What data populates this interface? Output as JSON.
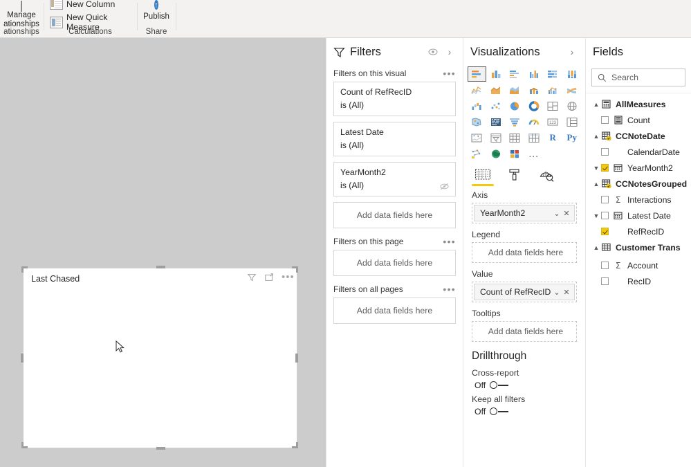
{
  "ribbon": {
    "groups": [
      {
        "caption": "ationships",
        "items": [
          {
            "label": "Manage",
            "label2": "ationships",
            "icon": "manage-relationships-icon"
          }
        ]
      },
      {
        "caption": "Calculations",
        "items": [
          {
            "label": "New Column",
            "icon": "new-column-icon"
          },
          {
            "label": "New Quick Measure",
            "icon": "new-quick-measure-icon"
          }
        ]
      },
      {
        "caption": "Share",
        "items": [
          {
            "label": "Publish",
            "icon": "publish-icon"
          }
        ]
      }
    ]
  },
  "canvas": {
    "visual": {
      "title": "Last Chased",
      "header_icons": [
        "filter-icon",
        "focus-mode-icon",
        "more-options-icon"
      ],
      "selected": true
    },
    "cursor": "mouse-pointer"
  },
  "filters": {
    "title": "Filters",
    "header_icons": [
      "hidden-eye-icon",
      "collapse-chevron-icon"
    ],
    "sections": [
      {
        "label": "Filters on this visual",
        "cards": [
          {
            "field": "Count of RefRecID",
            "state": "is (All)",
            "hidden": false
          },
          {
            "field": "Latest Date",
            "state": "is (All)",
            "hidden": false
          },
          {
            "field": "YearMonth2",
            "state": "is (All)",
            "hidden": true
          }
        ],
        "dropzone": "Add data fields here"
      },
      {
        "label": "Filters on this page",
        "cards": [],
        "dropzone": "Add data fields here"
      },
      {
        "label": "Filters on all pages",
        "cards": [],
        "dropzone": "Add data fields here"
      }
    ]
  },
  "visualizations": {
    "title": "Visualizations",
    "header_icon": "collapse-chevron-icon",
    "gallery": [
      {
        "name": "stacked-bar-chart-icon",
        "selected": true
      },
      {
        "name": "stacked-column-chart-icon",
        "selected": false
      },
      {
        "name": "clustered-bar-chart-icon",
        "selected": false
      },
      {
        "name": "clustered-column-chart-icon",
        "selected": false
      },
      {
        "name": "100-percent-stacked-bar-chart-icon",
        "selected": false
      },
      {
        "name": "100-percent-stacked-column-chart-icon",
        "selected": false
      },
      {
        "name": "line-chart-icon",
        "selected": false
      },
      {
        "name": "area-chart-icon",
        "selected": false
      },
      {
        "name": "stacked-area-chart-icon",
        "selected": false
      },
      {
        "name": "line-and-stacked-column-chart-icon",
        "selected": false
      },
      {
        "name": "line-and-clustered-column-chart-icon",
        "selected": false
      },
      {
        "name": "ribbon-chart-icon",
        "selected": false
      },
      {
        "name": "waterfall-chart-icon",
        "selected": false
      },
      {
        "name": "scatter-chart-icon",
        "selected": false
      },
      {
        "name": "pie-chart-icon",
        "selected": false
      },
      {
        "name": "donut-chart-icon",
        "selected": false
      },
      {
        "name": "treemap-icon",
        "selected": false
      },
      {
        "name": "map-icon",
        "selected": false
      },
      {
        "name": "filled-map-icon",
        "selected": false
      },
      {
        "name": "shape-map-icon",
        "selected": false
      },
      {
        "name": "funnel-chart-icon",
        "selected": false
      },
      {
        "name": "gauge-icon",
        "selected": false
      },
      {
        "name": "card-icon",
        "selected": false
      },
      {
        "name": "multi-row-card-icon",
        "selected": false
      },
      {
        "name": "kpi-icon",
        "selected": false
      },
      {
        "name": "slicer-icon",
        "selected": false
      },
      {
        "name": "table-icon",
        "selected": false
      },
      {
        "name": "matrix-icon",
        "selected": false
      },
      {
        "name": "r-script-visual-icon",
        "label": "R",
        "selected": false
      },
      {
        "name": "python-visual-icon",
        "label": "Py",
        "selected": false
      },
      {
        "name": "key-influencers-icon",
        "selected": false
      },
      {
        "name": "arcgis-map-icon",
        "selected": false
      },
      {
        "name": "power-apps-visual-icon",
        "selected": false
      },
      {
        "name": "more-visuals-icon",
        "label": "...",
        "selected": false
      }
    ],
    "well_tabs": [
      {
        "name": "fields-tab-icon",
        "active": true
      },
      {
        "name": "format-tab-icon",
        "active": false
      },
      {
        "name": "analytics-tab-icon",
        "active": false
      }
    ],
    "wells": [
      {
        "label": "Axis",
        "value": "YearMonth2",
        "empty": false,
        "placeholder": "Add data fields here"
      },
      {
        "label": "Legend",
        "value": "",
        "empty": true,
        "placeholder": "Add data fields here"
      },
      {
        "label": "Value",
        "value": "Count of RefRecID",
        "empty": false,
        "placeholder": "Add data fields here"
      },
      {
        "label": "Tooltips",
        "value": "",
        "empty": true,
        "placeholder": "Add data fields here"
      }
    ],
    "drillthrough": {
      "title": "Drillthrough",
      "options": [
        {
          "label": "Cross-report",
          "state": "Off"
        },
        {
          "label": "Keep all filters",
          "state": "Off"
        }
      ]
    }
  },
  "fields": {
    "title": "Fields",
    "search_placeholder": "Search",
    "search_icon": "search-icon",
    "tree": [
      {
        "name": "AllMeasures",
        "type": "table",
        "icon": "measure-table-icon",
        "expanded": true,
        "level": 0
      },
      {
        "name": "Count",
        "type": "measure",
        "icon": "measure-icon",
        "checked": false,
        "level": 1
      },
      {
        "name": "CCNoteDate",
        "type": "table",
        "icon": "date-table-icon",
        "expanded": true,
        "level": 0
      },
      {
        "name": "CalendarDate",
        "type": "field",
        "icon": "",
        "checked": false,
        "level": 1
      },
      {
        "name": "YearMonth2",
        "type": "date-hierarchy",
        "icon": "calendar-icon",
        "checked": true,
        "expandable": true,
        "level": 1
      },
      {
        "name": "CCNotesGrouped",
        "type": "table",
        "icon": "date-table-icon",
        "expanded": true,
        "level": 0
      },
      {
        "name": "Interactions",
        "type": "numeric-field",
        "icon": "sigma-icon",
        "checked": false,
        "level": 1
      },
      {
        "name": "Latest Date",
        "type": "date-hierarchy",
        "icon": "calendar-icon",
        "checked": false,
        "expandable": true,
        "level": 1
      },
      {
        "name": "RefRecID",
        "type": "field",
        "icon": "",
        "checked": true,
        "level": 2
      },
      {
        "name": "Customer Trans",
        "type": "table",
        "icon": "table-icon",
        "expanded": true,
        "level": 0
      },
      {
        "name": "Account",
        "type": "numeric-field",
        "icon": "sigma-icon",
        "checked": false,
        "level": 1
      },
      {
        "name": "RecID",
        "type": "field",
        "icon": "",
        "checked": false,
        "level": 1
      }
    ]
  },
  "colors": {
    "accent_yellow": "#f2c811",
    "canvas_gray": "#cccccc",
    "ribbon_gray": "#f3f2f1",
    "publish_blue": "#2f7dc4"
  }
}
